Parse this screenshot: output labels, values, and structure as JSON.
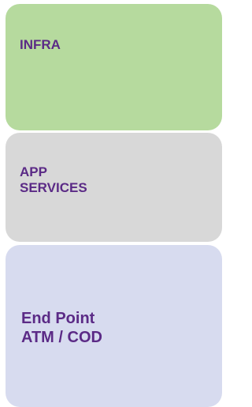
{
  "layers": {
    "infra": {
      "lines": [
        "INFRA"
      ],
      "color": "#b6da9e"
    },
    "app_services": {
      "lines": [
        "APP",
        "SERVICES"
      ],
      "color": "#d8d8d8"
    },
    "end_point": {
      "lines": [
        "End Point",
        "ATM / COD"
      ],
      "color": "#d7dbef"
    }
  },
  "text_color": "#5b2a86"
}
